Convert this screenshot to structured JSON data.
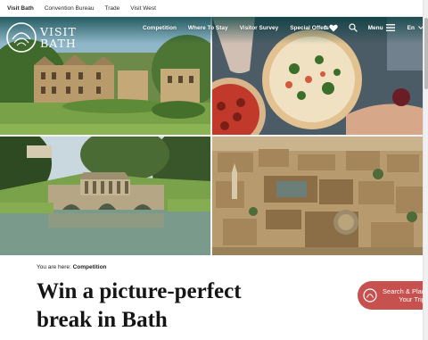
{
  "topbar": {
    "links": [
      {
        "label": "Visit Bath",
        "active": true
      },
      {
        "label": "Convention Bureau",
        "active": false
      },
      {
        "label": "Trade",
        "active": false
      },
      {
        "label": "Visit West",
        "active": false
      }
    ]
  },
  "header": {
    "logo": {
      "line1": "VISIT",
      "line2": "BATH"
    },
    "nav": [
      {
        "label": "Competition"
      },
      {
        "label": "Where To Stay"
      },
      {
        "label": "Visitor Survey"
      },
      {
        "label": "Special Offers"
      }
    ],
    "favourites_count": "0",
    "menu_label": "Menu",
    "language": "En",
    "icons": {
      "favourites": "heart-icon",
      "search": "search-icon",
      "menu": "hamburger-icon",
      "language": "chevron-down-icon"
    }
  },
  "hero": {
    "tiles": [
      {
        "subject": "country-house"
      },
      {
        "subject": "pizza-table"
      },
      {
        "subject": "palladian-bridge"
      },
      {
        "subject": "bath-aerial"
      }
    ]
  },
  "breadcrumb": {
    "prefix": "You are here:",
    "current": "Competition"
  },
  "page": {
    "title": "Win a picture-perfect break in Bath"
  },
  "cta": {
    "line1": "Search & Plan",
    "line2": "Your Trip",
    "color": "#c7514f",
    "icon": "search-plan-icon"
  },
  "colors": {
    "header_overlay": "#003c3c",
    "cta": "#c7514f",
    "title": "#151515"
  }
}
